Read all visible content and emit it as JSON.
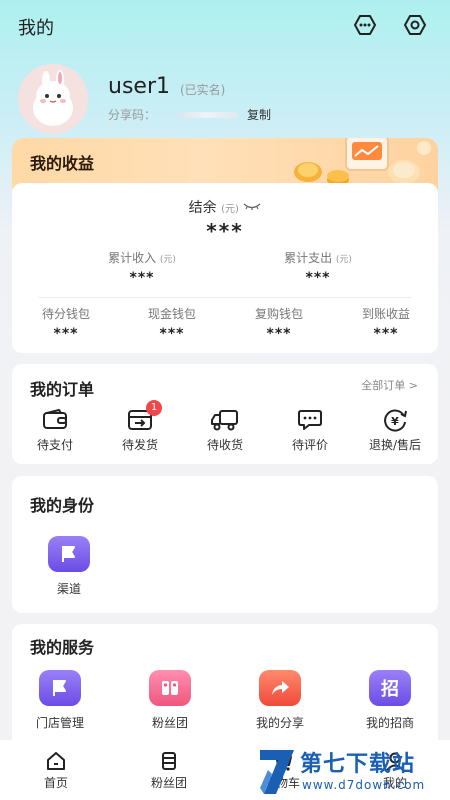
{
  "header": {
    "title": "我的",
    "more_icon": "more-icon",
    "eye_icon": "eye-icon"
  },
  "profile": {
    "username": "user1",
    "verified": "(已实名)",
    "share_label": "分享码：",
    "copy": "复制"
  },
  "earnings": {
    "title": "我的收益",
    "balance_label": "结余",
    "balance_unit": "(元)",
    "balance_value": "***",
    "total_income_label": "累计收入",
    "total_income_unit": "(元)",
    "total_income_value": "***",
    "total_expense_label": "累计支出",
    "total_expense_unit": "(元)",
    "total_expense_value": "***",
    "wallets": [
      {
        "label": "待分钱包",
        "value": "***"
      },
      {
        "label": "现金钱包",
        "value": "***"
      },
      {
        "label": "复购钱包",
        "value": "***"
      },
      {
        "label": "到账收益",
        "value": "***"
      }
    ]
  },
  "orders": {
    "title": "我的订单",
    "all": "全部订单 >",
    "items": [
      {
        "label": "待支付",
        "icon": "wallet-icon"
      },
      {
        "label": "待发货",
        "icon": "box-icon",
        "badge": "1"
      },
      {
        "label": "待收货",
        "icon": "truck-icon"
      },
      {
        "label": "待评价",
        "icon": "comment-icon"
      },
      {
        "label": "退换/售后",
        "icon": "refund-icon"
      }
    ]
  },
  "identity": {
    "title": "我的身份",
    "items": [
      {
        "label": "渠道",
        "icon": "flag-icon"
      }
    ]
  },
  "services": {
    "title": "我的服务",
    "items": [
      {
        "label": "门店管理",
        "icon": "flag-icon"
      },
      {
        "label": "粉丝团",
        "icon": "fans-icon"
      },
      {
        "label": "我的分享",
        "icon": "share-icon"
      },
      {
        "label": "我的招商",
        "icon": "invite-icon",
        "glyph": "招"
      }
    ]
  },
  "tabbar": {
    "items": [
      {
        "label": "首页",
        "icon": "home-icon"
      },
      {
        "label": "粉丝团",
        "icon": "fans-tab-icon"
      },
      {
        "label": "购物车",
        "icon": "cart-icon"
      },
      {
        "label": "我的",
        "icon": "me-icon"
      }
    ]
  },
  "watermark": {
    "line1": "第七下载站",
    "line2": "www.d7down.com"
  },
  "colors": {
    "accent_purple": "#7b5cf0",
    "badge_red": "#f04848",
    "earn_orange": "#ffd9a6"
  }
}
